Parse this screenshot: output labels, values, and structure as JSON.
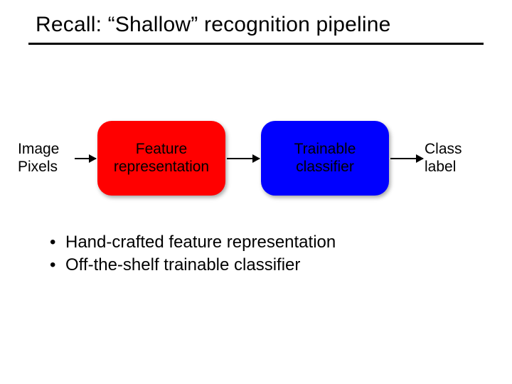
{
  "title": "Recall: “Shallow” recognition pipeline",
  "pipeline": {
    "input": "Image\nPixels",
    "stage1": "Feature\nrepresentation",
    "stage2": "Trainable\nclassifier",
    "output": "Class\nlabel"
  },
  "bullets": [
    "Hand-crafted feature representation",
    "Off-the-shelf trainable classifier"
  ],
  "colors": {
    "stage1_bg": "#ff0000",
    "stage2_bg": "#0000ff"
  }
}
